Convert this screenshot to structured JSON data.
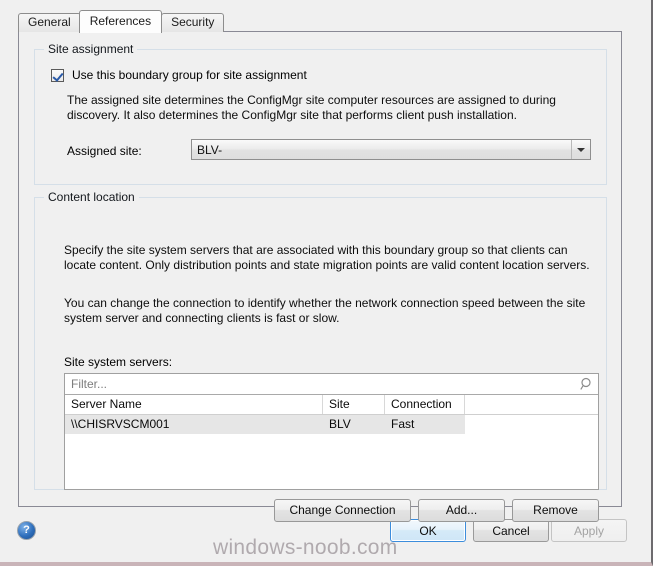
{
  "window": {
    "watermark": "windows-noob.com"
  },
  "tabs": [
    {
      "label": "General",
      "active": false
    },
    {
      "label": "References",
      "active": true
    },
    {
      "label": "Security",
      "active": false
    }
  ],
  "site_assignment": {
    "group_title": "Site assignment",
    "checkbox": {
      "label": "Use this boundary group for site assignment",
      "checked": true
    },
    "description": "The assigned site determines the ConfigMgr site computer resources are assigned to during discovery. It also determines the ConfigMgr site that performs client push installation.",
    "assigned_site_label": "Assigned site:",
    "assigned_site_value": "BLV-",
    "dropdown_icon": "chevron-down-icon"
  },
  "content_location": {
    "group_title": "Content location",
    "description_1": "Specify the site system servers that are associated with this boundary group so that clients can locate content. Only distribution points and state migration points are valid content location servers.",
    "description_2": "You can change the connection to identify whether the network connection speed between the site system server and connecting clients is fast or slow.",
    "list_label": "Site system servers:",
    "filter": {
      "placeholder": "Filter...",
      "value": "",
      "icon": "search-icon"
    },
    "columns": [
      "Server Name",
      "Site",
      "Connection",
      ""
    ],
    "rows": [
      {
        "server_name": "\\\\CHISRVSCM001",
        "site": "BLV",
        "connection": "Fast",
        "selected": true
      }
    ],
    "buttons": {
      "change_connection": "Change Connection",
      "add": "Add...",
      "remove": "Remove"
    }
  },
  "footer": {
    "help_icon": "help-icon",
    "help_glyph": "?",
    "ok": "OK",
    "cancel": "Cancel",
    "apply": "Apply"
  },
  "colors": {
    "redaction_blue": "#1614E0",
    "dialog_background": "#f0f0f0",
    "groupbox_border": "#d5dfe8",
    "selected_row": "#e6e6e6",
    "focus_border": "#3c8ddc"
  }
}
